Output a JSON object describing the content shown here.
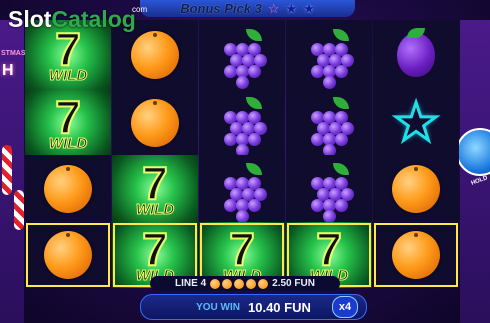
{
  "logo": {
    "part1": "Slot",
    "part2": "Catalog",
    "suffix": "com"
  },
  "header": {
    "title": "Bonus Pick 3",
    "stars": [
      "star-filled",
      "star-empty",
      "star-empty"
    ]
  },
  "side_left": {
    "text": "STMAS",
    "letter": "H"
  },
  "side_right": {
    "label": "HOLD"
  },
  "reels": [
    [
      "seven-wild",
      "seven-wild",
      "orange",
      "orange"
    ],
    [
      "orange",
      "orange",
      "seven-wild",
      "seven-wild"
    ],
    [
      "grapes",
      "grapes",
      "grapes",
      "seven-wild"
    ],
    [
      "grapes",
      "grapes",
      "grapes",
      "seven-wild"
    ],
    [
      "plum",
      "star",
      "orange",
      "orange"
    ]
  ],
  "highlight_row": 3,
  "symbols": {
    "seven_num": "7",
    "wild_label": "WILD"
  },
  "bottom": {
    "line_label": "LINE 4",
    "line_win": "2.50 FUN",
    "line_symbols": [
      "orange",
      "orange",
      "orange",
      "orange",
      "orange"
    ],
    "win_label": "YOU WIN",
    "win_amount": "10.40 FUN",
    "multiplier": "x4"
  },
  "colors": {
    "win_frame": "#ffe94a",
    "wild_glow": "#26c24a",
    "accent": "#1a3ad0"
  }
}
